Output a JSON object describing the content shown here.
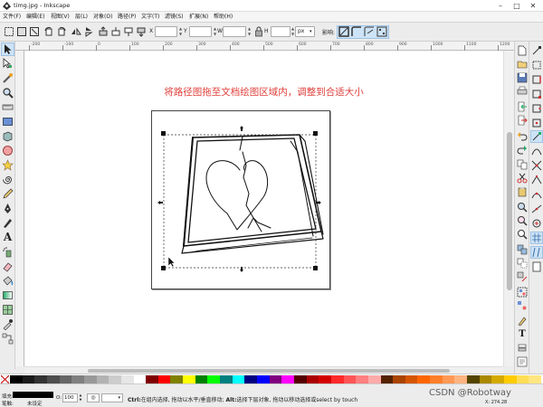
{
  "window": {
    "title": "timg.jpg - Inkscape",
    "controls": {
      "minimize": "–",
      "maximize": "□",
      "close": "✕"
    }
  },
  "menu": [
    {
      "label": "文件(F)",
      "id": "file"
    },
    {
      "label": "编辑(E)",
      "id": "edit"
    },
    {
      "label": "视图(V)",
      "id": "view"
    },
    {
      "label": "层(L)",
      "id": "layer"
    },
    {
      "label": "对象(O)",
      "id": "object"
    },
    {
      "label": "路径(P)",
      "id": "path"
    },
    {
      "label": "文字(T)",
      "id": "text"
    },
    {
      "label": "滤镜(S)",
      "id": "filters"
    },
    {
      "label": "扩展(N)",
      "id": "extensions"
    },
    {
      "label": "帮助(H)",
      "id": "help"
    }
  ],
  "toolbar": {
    "x_label": "X",
    "y_label": "Y",
    "w_label": "W",
    "h_label": "H",
    "unit": "px",
    "affect_label": "影响:"
  },
  "ruler": {
    "top_ticks": [
      "-200",
      "-100",
      "0",
      "100",
      "200",
      "300",
      "400",
      "500",
      "600",
      "700",
      "800",
      "900",
      "1000",
      "1100",
      "1200"
    ]
  },
  "canvas": {
    "instruction": "将路径图拖至文档绘图区域内，调整到合适大小"
  },
  "colors": {
    "instruction": "#e0403c",
    "selected_tool": "#cde3f7"
  },
  "palette": {
    "swatches": [
      "#000000",
      "#1a1a1a",
      "#333333",
      "#4d4d4d",
      "#666666",
      "#808080",
      "#999999",
      "#b3b3b3",
      "#cccccc",
      "#e6e6e6",
      "#ffffff",
      "#800000",
      "#ff0000",
      "#808000",
      "#ffff00",
      "#008000",
      "#00ff00",
      "#008080",
      "#00ffff",
      "#000080",
      "#0000ff",
      "#800080",
      "#ff00ff",
      "#550000",
      "#aa0000",
      "#d40000",
      "#ff2a2a",
      "#ff5555",
      "#ff8080",
      "#ffaaaa",
      "#552200",
      "#aa4400",
      "#d45500",
      "#ff6600",
      "#ff7f2a",
      "#ff9955",
      "#ffb380",
      "#554400",
      "#aa8800",
      "#d4aa00",
      "#ffcc00",
      "#ffdd55",
      "#ffe680"
    ]
  },
  "status": {
    "fill_label": "填充:",
    "stroke_label": "笔触:",
    "stroke_value": "未设定",
    "opacity_label": "O:",
    "opacity_value": "100",
    "message_bold1": "Ctrl:",
    "message1": "在组内选择, 拖动以水平/垂直移动;",
    "message_bold2": "Alt:",
    "message2": "选择下层对象, 拖动以移动选择或select by touch",
    "coords": "X: 274.28",
    "watermark": "CSDN @Robotway"
  }
}
